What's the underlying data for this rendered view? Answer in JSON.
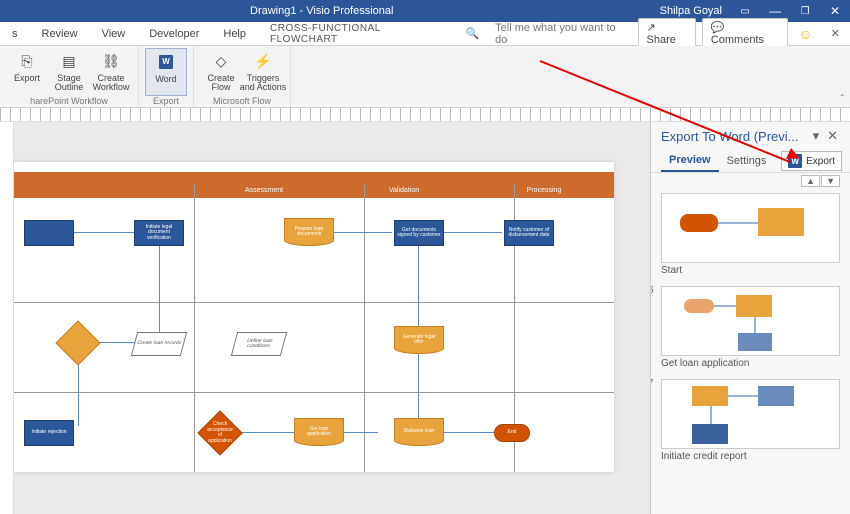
{
  "window": {
    "title": "Drawing1 - Visio Professional",
    "user": "Shilpa Goyal"
  },
  "tabs": {
    "items": [
      "s",
      "Review",
      "View",
      "Developer",
      "Help"
    ],
    "context": "CROSS-FUNCTIONAL FLOWCHART",
    "tellme_placeholder": "Tell me what you want to do",
    "share": "Share",
    "comments": "Comments"
  },
  "ribbon": {
    "groups": [
      {
        "label": "harePoint Workflow",
        "buttons": [
          {
            "label": "Export"
          },
          {
            "label": "Stage\nOutline"
          },
          {
            "label": "Create\nWorkflow"
          }
        ]
      },
      {
        "label": "Export",
        "buttons": [
          {
            "label": "Word",
            "selected": true
          }
        ]
      },
      {
        "label": "Microsoft Flow",
        "buttons": [
          {
            "label": "Create\nFlow"
          },
          {
            "label": "Triggers\nand Actions"
          }
        ]
      }
    ]
  },
  "diagram": {
    "columns": [
      "",
      "Assessment",
      "Validation",
      "Processing"
    ],
    "shapes": {
      "a1": "",
      "a2": "Initiate legal\ndocument\nverification",
      "b1": "Prepare loan\ndocuments",
      "b2": "Get documents\nsigned by customer",
      "b3": "Notify customer of\ndisbursement date",
      "c_dec1": "",
      "c_para1": "Create loan\nrecords",
      "c_para2": "Define loan\nconditions",
      "c_doc1": "Generate legal\noffer",
      "d1": "Initiate rejection",
      "d_dec2": "Check\nacceptance of\napplication",
      "d_doc2": "Get loan\napplication",
      "d_doc3": "Disburse loan",
      "d_end": "End"
    }
  },
  "pane": {
    "title": "Export To Word (Previ...",
    "tab_preview": "Preview",
    "tab_settings": "Settings",
    "export_btn": "Export",
    "items": [
      {
        "num": "",
        "caption": "Start"
      },
      {
        "num": "6",
        "caption": "Get loan application"
      },
      {
        "num": "7",
        "caption": "Initiate credit report"
      }
    ]
  }
}
